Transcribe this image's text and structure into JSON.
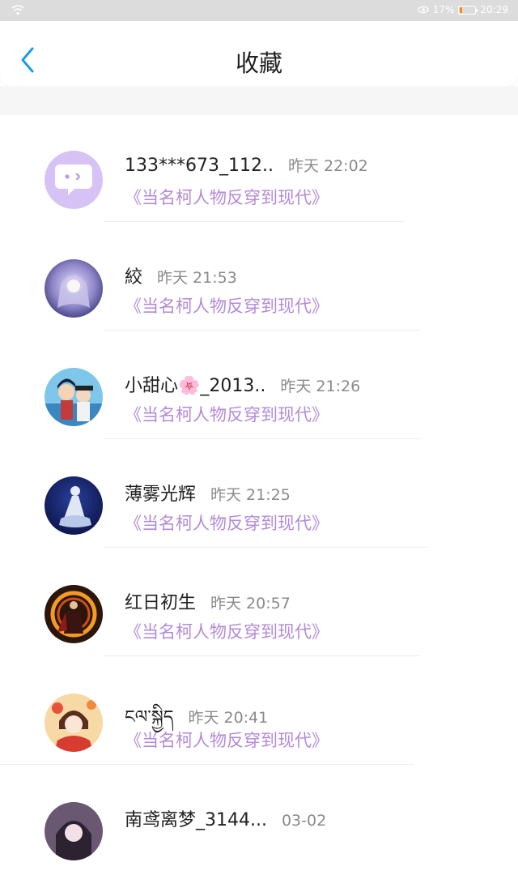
{
  "status_bar": {
    "battery": "17%",
    "time": "20:29",
    "battery_level": 0.17
  },
  "header": {
    "title": "收藏"
  },
  "favorites": [
    {
      "name": "133***673_112..",
      "time": "昨天 22:02",
      "book": "《当名柯人物反穿到现代》",
      "avatar": "chat-bubble-icon"
    },
    {
      "name": "絞",
      "time": "昨天 21:53",
      "book": "《当名柯人物反穿到现代》",
      "avatar": "anime-avatar"
    },
    {
      "name": "小甜心🌸_2013..",
      "time": "昨天 21:26",
      "book": "《当名柯人物反穿到现代》",
      "avatar": "anime-avatar"
    },
    {
      "name": "薄雾光辉",
      "time": "昨天 21:25",
      "book": "《当名柯人物反穿到现代》",
      "avatar": "anime-avatar"
    },
    {
      "name": "红日初生",
      "time": "昨天 20:57",
      "book": "《当名柯人物反穿到现代》",
      "avatar": "anime-avatar"
    },
    {
      "name": "ངལ་སྐྱིད",
      "time": "昨天 20:41",
      "book": "《当名柯人物反穿到现代》",
      "avatar": "anime-avatar"
    },
    {
      "name": "南鸢离梦_3144...",
      "time": "03-02",
      "book": "",
      "avatar": "anime-avatar"
    }
  ],
  "colors": {
    "accent": "#1a9bf0",
    "book_title": "#b38ad8",
    "time": "#8a8a8a"
  }
}
